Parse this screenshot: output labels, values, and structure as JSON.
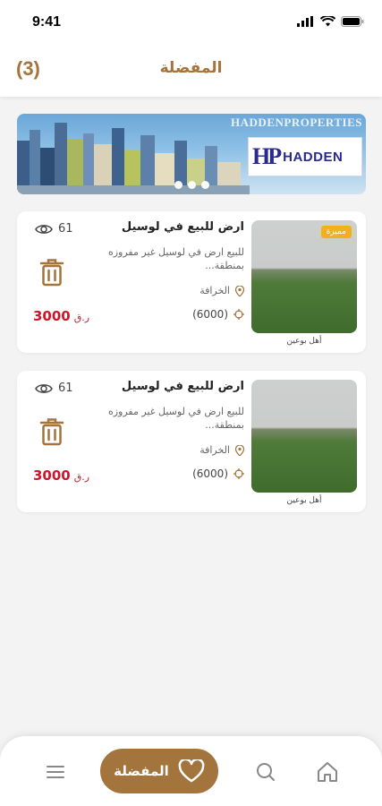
{
  "status_bar": {
    "time": "9:41"
  },
  "header": {
    "count": "(3)",
    "title": "المفضلة"
  },
  "banner": {
    "brand_text": "HADDENPROPERTIES",
    "logo_mark": "HP",
    "logo_word": "HADDEN",
    "slide_count": 3
  },
  "listings": [
    {
      "badge": "مميزة",
      "title": "ارض للبيع في لوسيل",
      "description": "للبيع ارض في لوسيل غير مفروزه بمنطقة...",
      "location": "الخرافة",
      "area": "(6000)",
      "views": "61",
      "price": "3000",
      "currency": "ر.ق",
      "agent": "أهل بوعين"
    },
    {
      "badge": "",
      "title": "ارض للبيع في لوسيل",
      "description": "للبيع ارض في لوسيل غير مفروزه بمنطقة...",
      "location": "الخرافة",
      "area": "(6000)",
      "views": "61",
      "price": "3000",
      "currency": "ر.ق",
      "agent": "أهل بوعين"
    }
  ],
  "bottom_nav": {
    "favorites_label": "المفضلة",
    "icons": [
      "home-icon",
      "search-icon",
      "heart-icon",
      "menu-icon"
    ]
  },
  "colors": {
    "accent": "#a3743c",
    "price": "#d0152a",
    "badge": "#f2b01e",
    "background": "#f3f3f3"
  }
}
